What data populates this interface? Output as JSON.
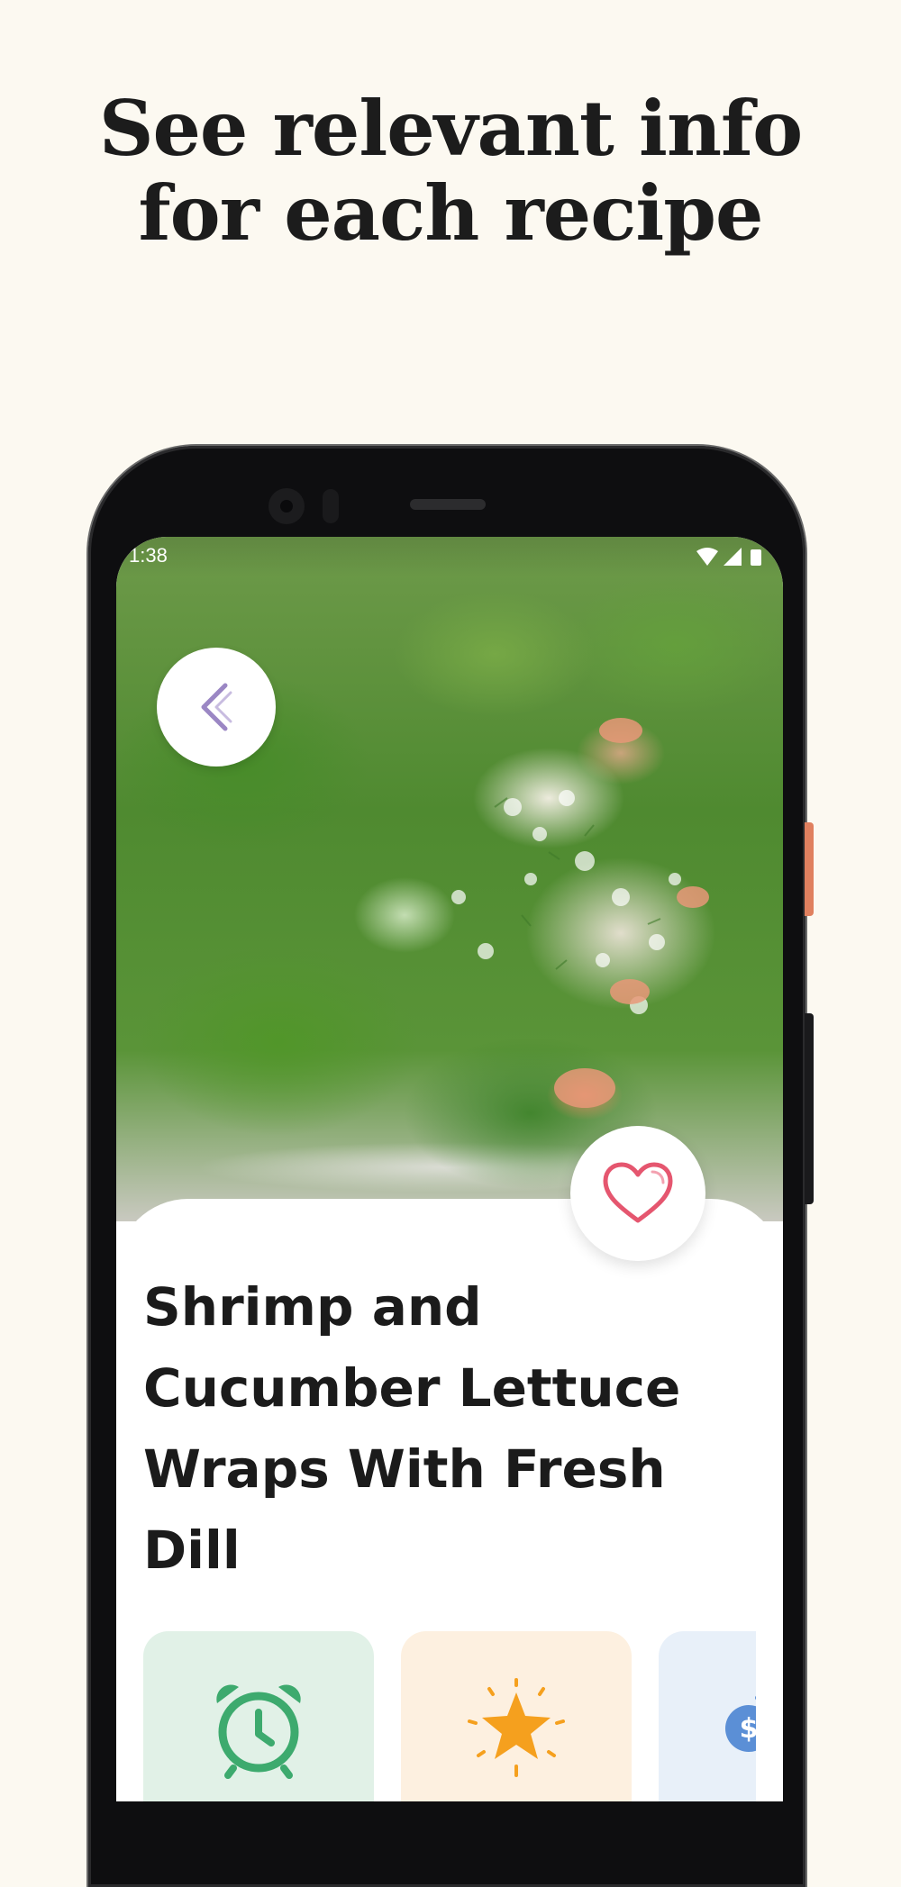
{
  "headline": {
    "line1": "See relevant info",
    "line2": "for each recipe"
  },
  "status_bar": {
    "time": "1:38"
  },
  "recipe": {
    "title": "Shrimp and Cucumber Lettuce Wraps With Fresh Dill",
    "favorited": false
  },
  "icons": {
    "back": "chevron-left-icon",
    "favorite": "heart-icon",
    "time": "alarm-clock-icon",
    "difficulty": "star-icon",
    "cost": "dollar-coin-icon"
  },
  "colors": {
    "background": "#fcf9f1",
    "time_tile": "#e1f1e7",
    "time_icon": "#3daa6e",
    "difficulty_tile": "#fdf0e0",
    "difficulty_icon": "#f5a01e",
    "cost_tile": "#e8f0f9",
    "cost_icon": "#5b8fd6",
    "heart": "#e5566f",
    "back_chevron": "#9b87c4"
  }
}
